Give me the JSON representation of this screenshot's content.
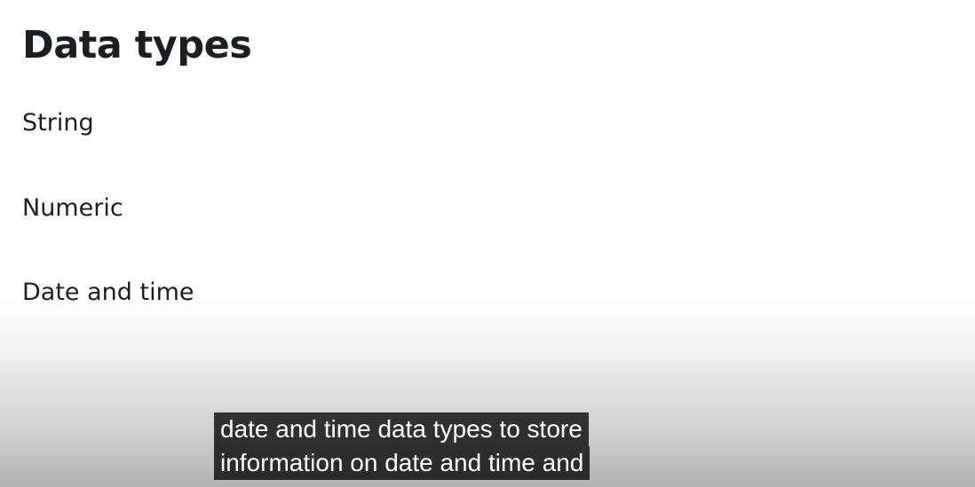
{
  "slide": {
    "title": "Data types",
    "items": [
      {
        "label": "String"
      },
      {
        "label": "Numeric"
      },
      {
        "label": "Date and time"
      }
    ]
  },
  "captions": {
    "lines": [
      "date and time data types to store",
      "information on date and time and"
    ]
  }
}
